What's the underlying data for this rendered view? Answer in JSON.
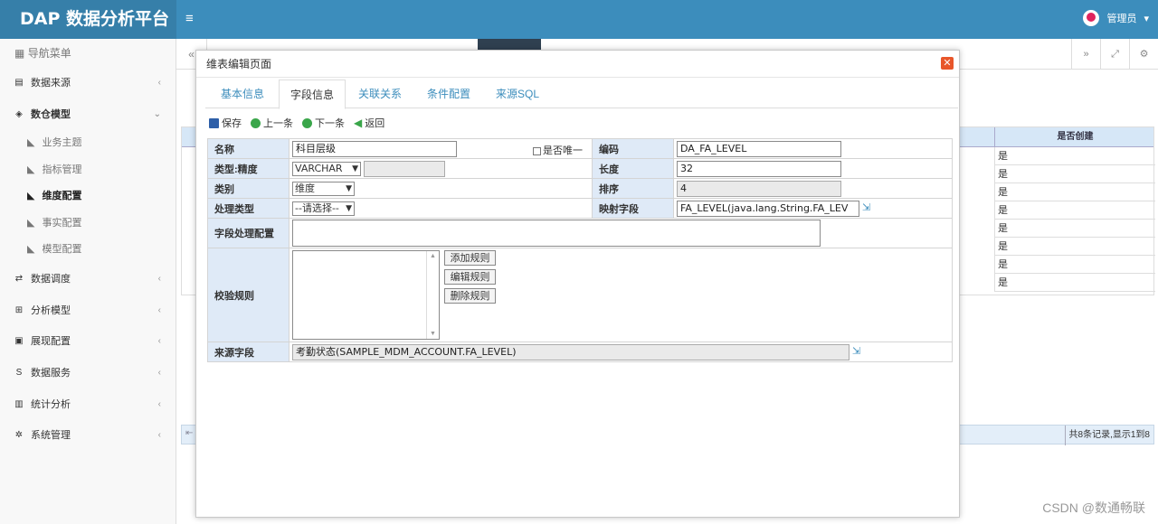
{
  "app": {
    "title": "DAP 数据分析平台",
    "user": "管理员",
    "watermark": "CSDN @数通畅联"
  },
  "sidebar": {
    "title": "导航菜单",
    "items": [
      {
        "label": "数据来源",
        "icon": "database-icon"
      },
      {
        "label": "数仓模型",
        "icon": "cubes-icon"
      },
      {
        "label": "数据调度",
        "icon": "shuffle-icon"
      },
      {
        "label": "分析模型",
        "icon": "sitemap-icon"
      },
      {
        "label": "展现配置",
        "icon": "film-icon"
      },
      {
        "label": "数据服务",
        "icon": "s-icon"
      },
      {
        "label": "统计分析",
        "icon": "bar-chart-icon"
      },
      {
        "label": "系统管理",
        "icon": "gear-icon"
      }
    ],
    "sub_items": [
      "业务主题",
      "指标管理",
      "维度配置",
      "事实配置",
      "模型配置"
    ]
  },
  "background_grid": {
    "column_header": "是否创建",
    "rows": [
      "是",
      "是",
      "是",
      "是",
      "是",
      "是",
      "是",
      "是"
    ],
    "pager_info": "共8条记录,显示1到8"
  },
  "modal": {
    "title": "维表编辑页面",
    "tabs": [
      "基本信息",
      "字段信息",
      "关联关系",
      "条件配置",
      "来源SQL"
    ],
    "toolbar": {
      "save": "保存",
      "prev": "上一条",
      "next": "下一条",
      "back": "返回"
    },
    "form": {
      "name_label": "名称",
      "name_value": "科目层级",
      "unique_label": "是否唯一",
      "code_label": "编码",
      "code_value": "DA_FA_LEVEL",
      "type_label": "类型:精度",
      "type_value": "VARCHAR",
      "length_label": "长度",
      "length_value": "32",
      "category_label": "类别",
      "category_value": "维度",
      "order_label": "排序",
      "order_value": "4",
      "process_type_label": "处理类型",
      "process_type_value": "--请选择--",
      "mapping_label": "映射字段",
      "mapping_value": "FA_LEVEL(java.lang.String.FA_LEV",
      "process_config_label": "字段处理配置",
      "validation_label": "校验规则",
      "add_rule": "添加规则",
      "edit_rule": "编辑规则",
      "delete_rule": "删除规则",
      "source_label": "来源字段",
      "source_value": "考勤状态(SAMPLE_MDM_ACCOUNT.FA_LEVEL)"
    }
  }
}
